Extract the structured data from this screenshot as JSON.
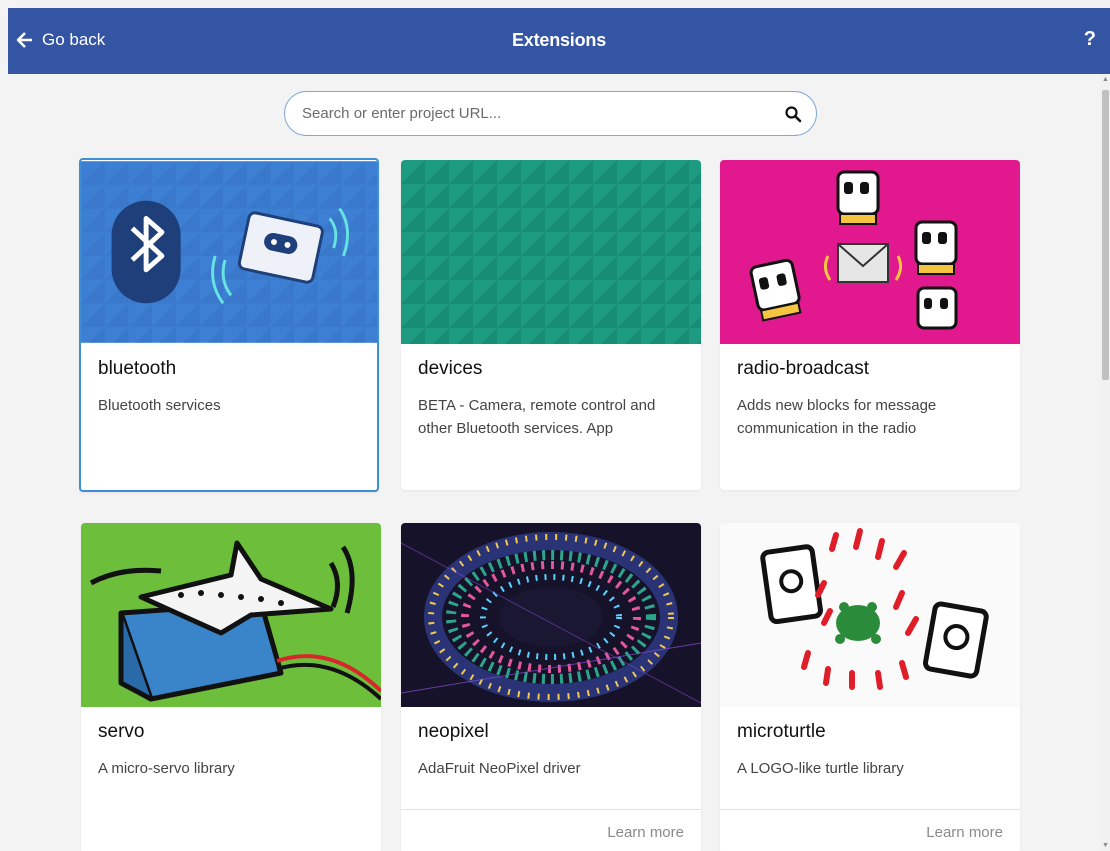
{
  "header": {
    "back_label": "Go back",
    "title": "Extensions",
    "help_label": "?",
    "background": "#3454a4"
  },
  "search": {
    "placeholder": "Search or enter project URL...",
    "icon": "search-icon"
  },
  "cards": [
    {
      "name": "bluetooth",
      "description": "Bluetooth services",
      "image": "bluetooth-illustration",
      "selected": true
    },
    {
      "name": "devices",
      "description": "BETA - Camera, remote control and other Bluetooth services. App",
      "image": "devices-pattern"
    },
    {
      "name": "radio-broadcast",
      "description": "Adds new blocks for message communication in the radio",
      "image": "radio-broadcast-illustration"
    },
    {
      "name": "servo",
      "description": "A micro-servo library",
      "image": "servo-illustration"
    },
    {
      "name": "neopixel",
      "description": "AdaFruit NeoPixel driver",
      "image": "neopixel-photo",
      "learn_more": "Learn more"
    },
    {
      "name": "microturtle",
      "description": "A LOGO-like turtle library",
      "image": "microturtle-illustration",
      "learn_more": "Learn more"
    }
  ],
  "colors": {
    "accent": "#3454a4",
    "selection": "#3f8fd8",
    "bluetooth": "#3c7fd1",
    "devices": "#1a9a7d",
    "radio": "#e21a8e",
    "servo": "#6cbf3a"
  }
}
